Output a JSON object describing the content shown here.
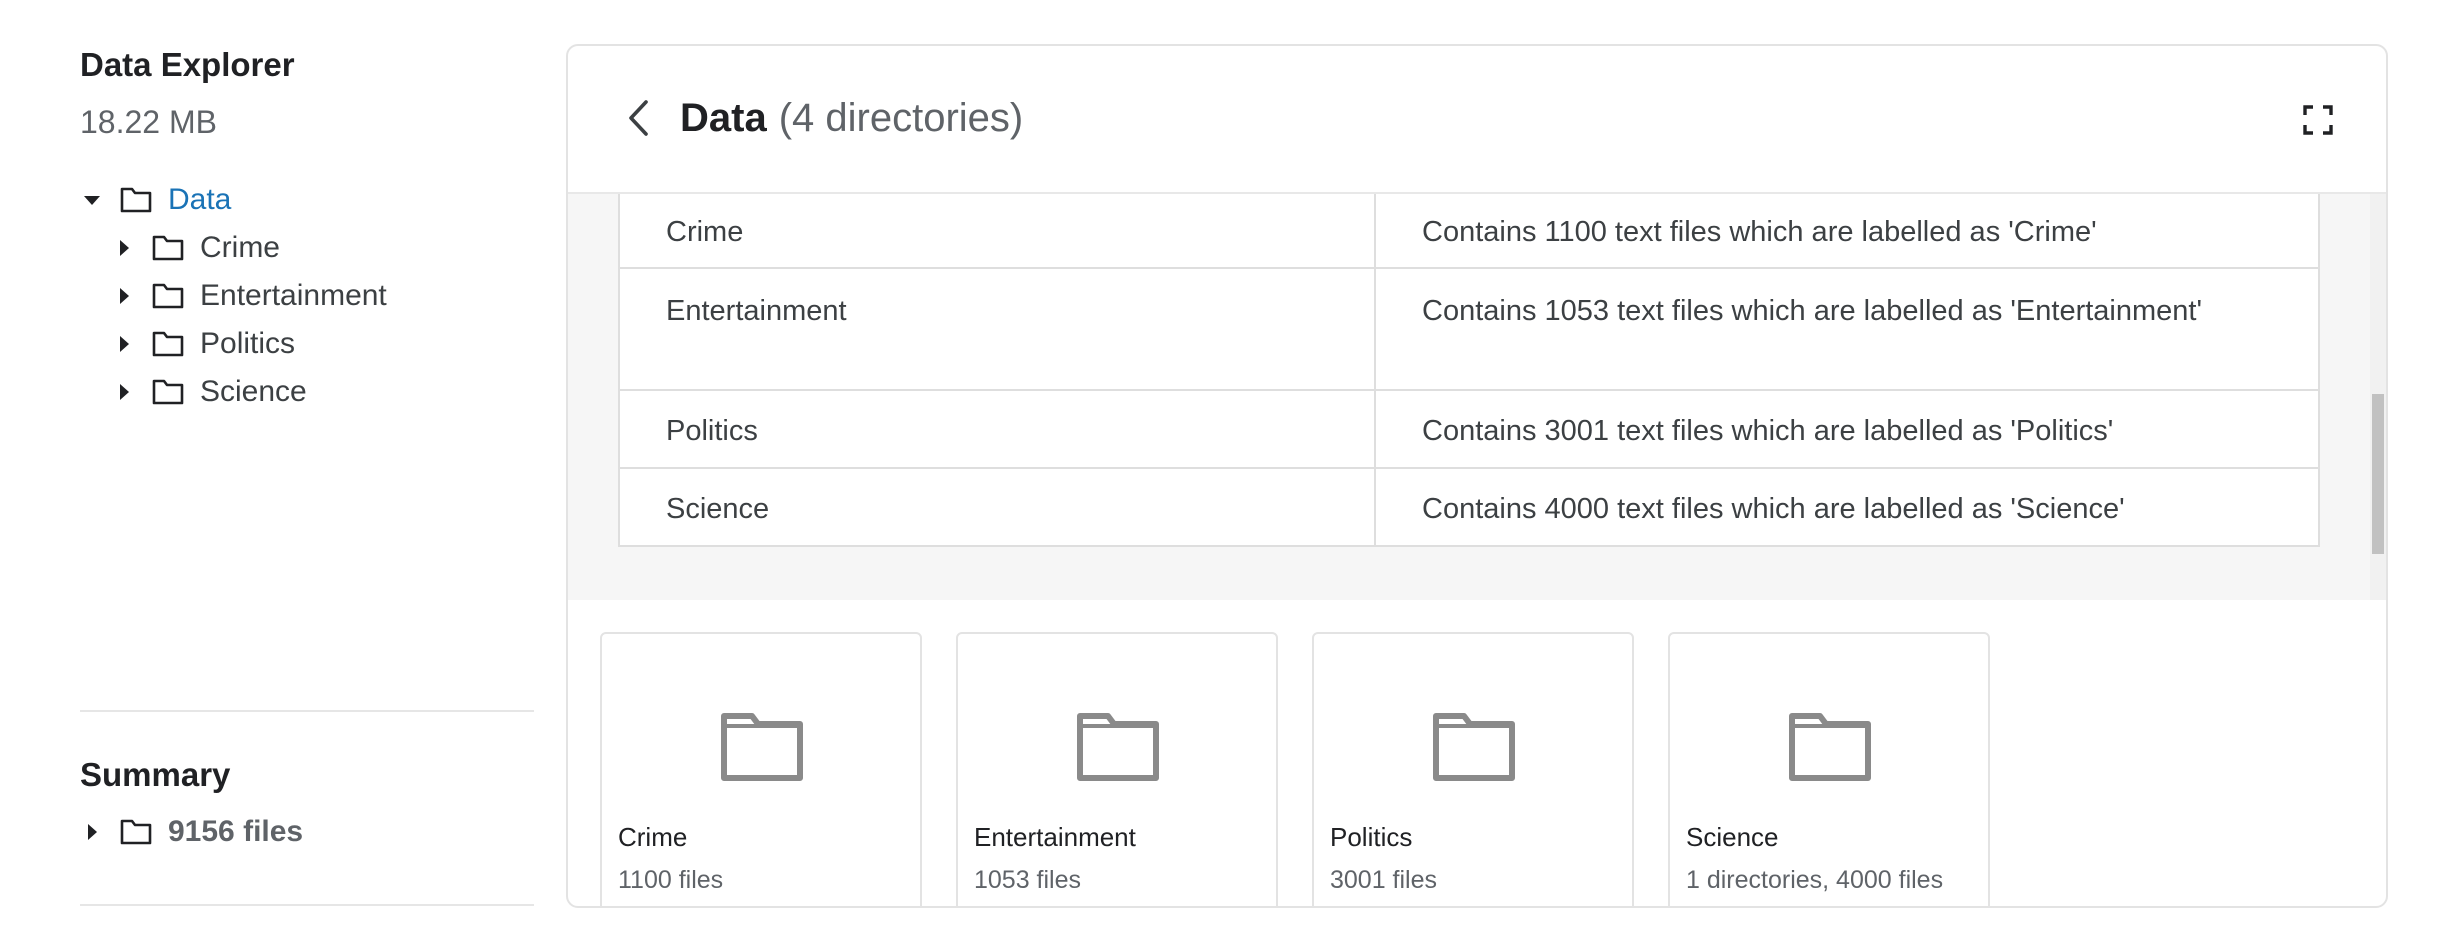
{
  "sidebar": {
    "title": "Data Explorer",
    "size": "18.22 MB",
    "tree": {
      "root": {
        "label": "Data",
        "icon": "folder-icon",
        "expanded": true
      },
      "children": [
        {
          "label": "Crime",
          "icon": "folder-icon"
        },
        {
          "label": "Entertainment",
          "icon": "folder-icon"
        },
        {
          "label": "Politics",
          "icon": "folder-icon"
        },
        {
          "label": "Science",
          "icon": "folder-icon"
        }
      ]
    },
    "summary": {
      "title": "Summary",
      "files": "9156 files"
    }
  },
  "panel": {
    "title": "Data",
    "count": "(4 directories)",
    "back_icon": "chevron-left-icon",
    "expand_icon": "fullscreen-icon",
    "table": {
      "rows": [
        {
          "name": "Crime",
          "description": "Contains 1100 text files which are labelled as 'Crime'"
        },
        {
          "name": "Entertainment",
          "description": "Contains 1053 text files which are labelled as 'Entertainment'"
        },
        {
          "name": "Politics",
          "description": "Contains 3001 text files which are labelled as 'Politics'"
        },
        {
          "name": "Science",
          "description": "Contains 4000 text files which are labelled as 'Science'"
        }
      ]
    },
    "cards": [
      {
        "name": "Crime",
        "meta": "1100 files"
      },
      {
        "name": "Entertainment",
        "meta": "1053 files"
      },
      {
        "name": "Politics",
        "meta": "3001 files"
      },
      {
        "name": "Science",
        "meta": "1 directories, 4000 files"
      }
    ]
  },
  "colors": {
    "link": "#1a73b6",
    "icon_gray": "#8a8a8a",
    "border": "#e3e3e3"
  }
}
